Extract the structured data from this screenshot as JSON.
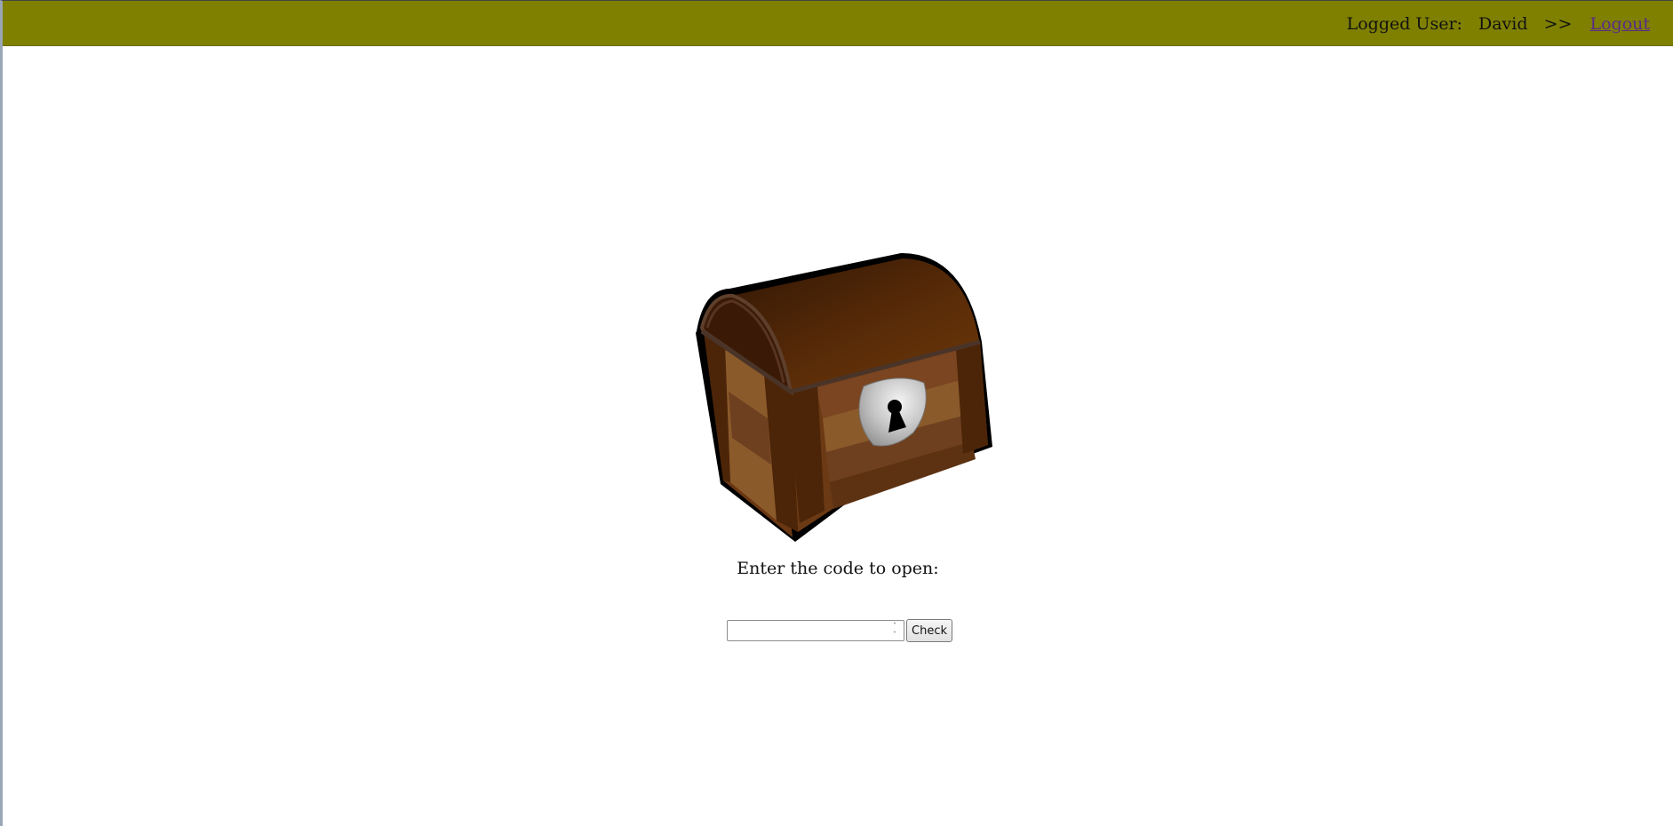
{
  "header": {
    "logged_user_label": "Logged User:",
    "user_name": "David",
    "separator": ">>",
    "logout_label": "Logout"
  },
  "main": {
    "chest_icon": "treasure-chest-icon",
    "prompt": "Enter the code to open:",
    "code_input": {
      "value": "",
      "placeholder": ""
    },
    "check_label": "Check"
  },
  "colors": {
    "topbar": "#7f8000",
    "chest_wood_dark": "#4a2207",
    "chest_wood_light": "#8b5a2b",
    "lock_plate": "#c9c9c9"
  }
}
